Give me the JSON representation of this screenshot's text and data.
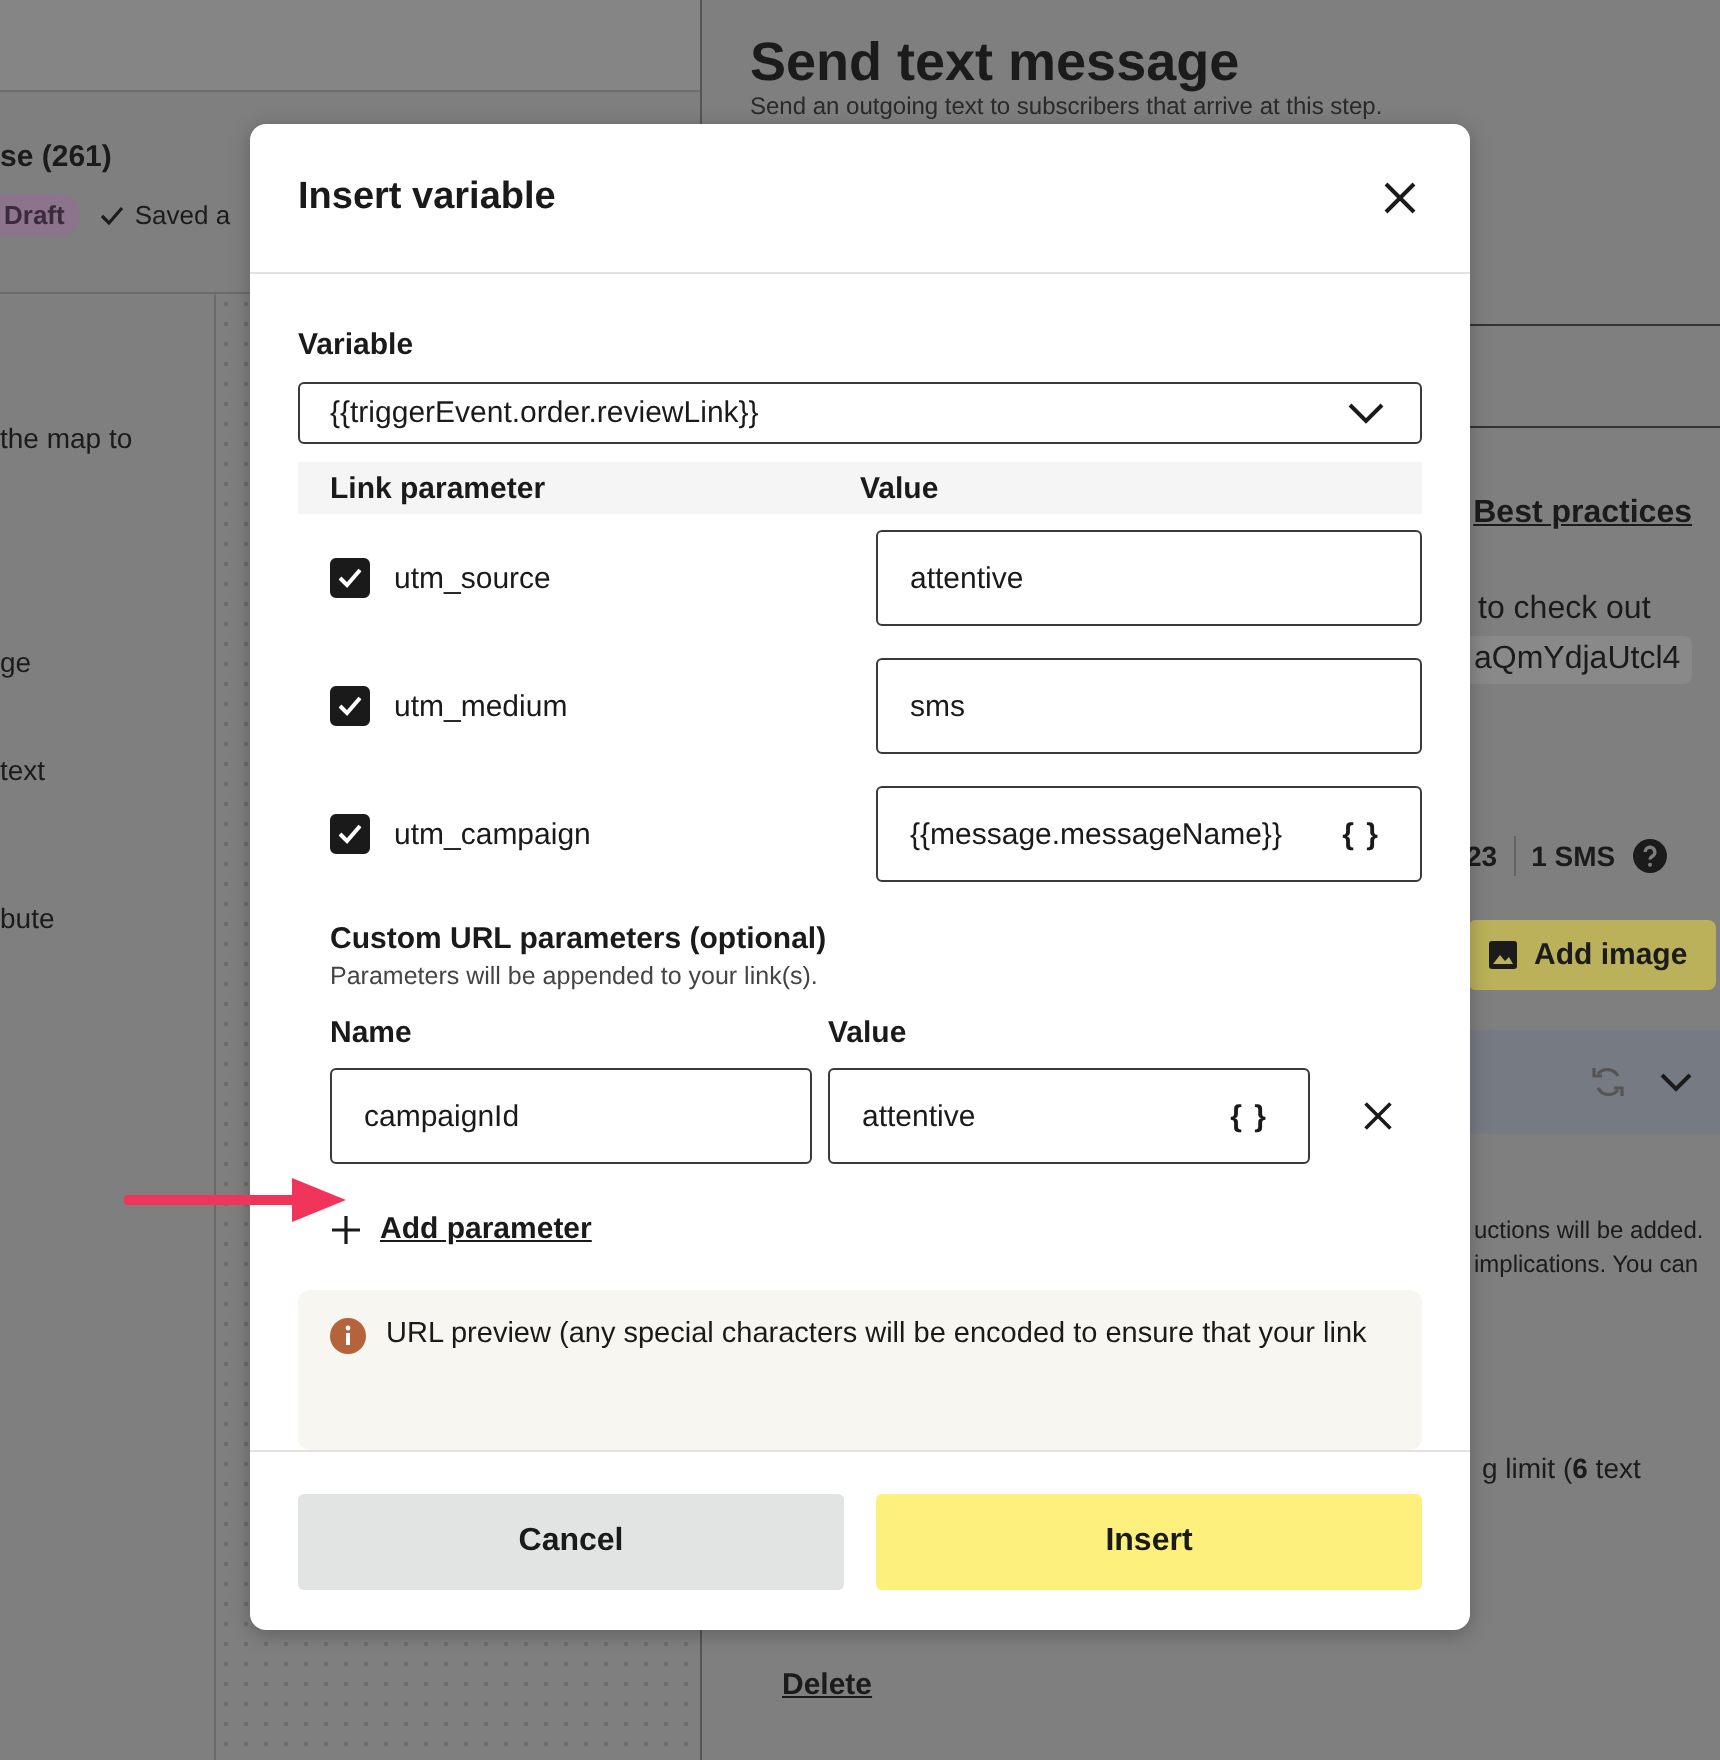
{
  "background": {
    "left_header": "se (261)",
    "status_badge": "Draft",
    "saved_text": "Saved a",
    "left_items": [
      "the map to",
      "ge",
      "text",
      "bute"
    ],
    "title": "Send text message",
    "subtitle": "Send an outgoing text to subscribers that arrive at this step.",
    "best_practices_link": "Best practices",
    "message_text": "to check out",
    "message_link": "aQmYdjaUtcl4",
    "char_count": "23",
    "sms_count": "1 SMS",
    "add_image_button": "Add image",
    "notice_lines": [
      "uctions will be added.",
      "implications. You can"
    ],
    "limit_text": "g limit (**6** text",
    "delete_link": "Delete"
  },
  "dialog": {
    "title": "Insert variable",
    "variable_label": "Variable",
    "variable_value": "{{triggerEvent.order.reviewLink}}",
    "link_columns": [
      "Link parameter",
      "Value"
    ],
    "link_parameters": [
      {
        "name": "utm_source",
        "checked": true,
        "value": "attentive"
      },
      {
        "name": "utm_medium",
        "checked": true,
        "value": "sms"
      },
      {
        "name": "utm_campaign",
        "checked": true,
        "value": "{{message.messageName}}",
        "insert_icon": "{ }"
      }
    ],
    "custom_title": "Custom URL parameters (optional)",
    "custom_hint": "Parameters will be appended to your link(s).",
    "custom_columns": [
      "Name",
      "Value"
    ],
    "custom_parameters": [
      {
        "name": "campaignId",
        "value": "attentive",
        "insert_icon": "{ }"
      }
    ],
    "add_parameter": "Add parameter",
    "url_preview": "URL preview (any special characters will be encoded to ensure that your link",
    "buttons": [
      {
        "label": "Cancel",
        "kind": "secondary"
      },
      {
        "label": "Insert",
        "kind": "primary"
      }
    ]
  }
}
